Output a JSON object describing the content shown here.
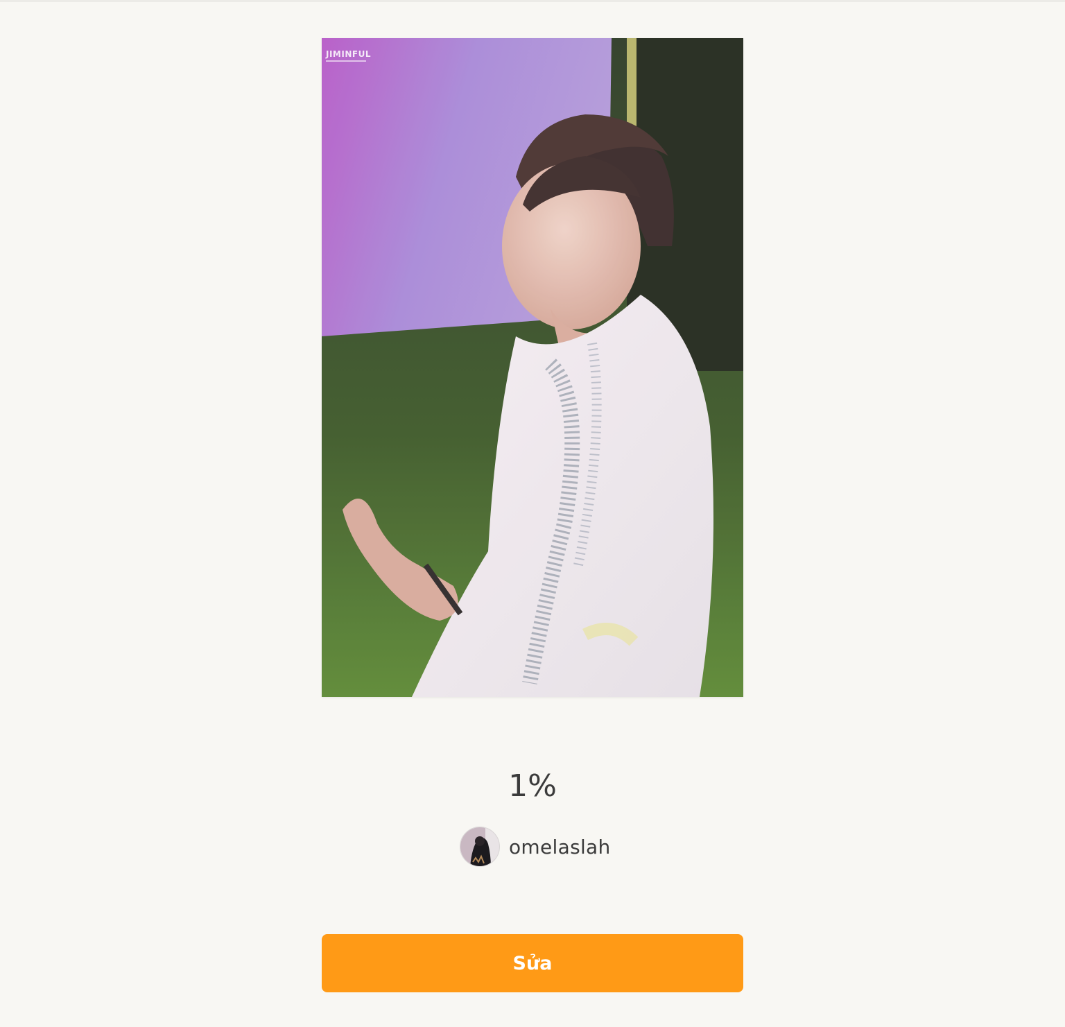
{
  "story": {
    "cover_watermark": "JIMINFUL",
    "title": "1%",
    "author": {
      "username": "omelaslah"
    }
  },
  "actions": {
    "edit_label": "Sửa"
  },
  "colors": {
    "background": "#f8f7f3",
    "accent": "#ff9a16",
    "text": "#3b3b3b"
  }
}
